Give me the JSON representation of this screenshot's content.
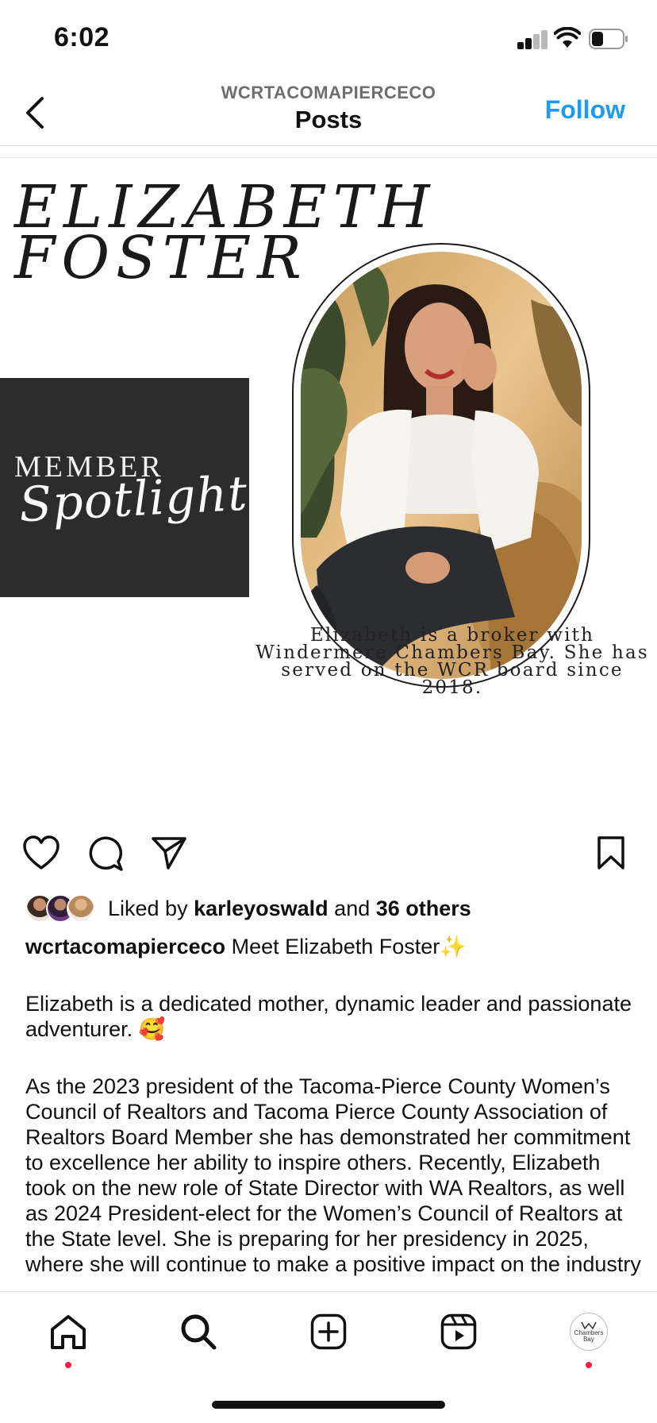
{
  "status_bar": {
    "time": "6:02",
    "icons": [
      "cellular-signal-icon",
      "wifi-icon",
      "battery-icon"
    ]
  },
  "header": {
    "username": "WCRTACOMAPIERCECO",
    "title": "Posts",
    "follow_label": "Follow",
    "back_icon": "chevron-left-icon",
    "follow_color": "#1d9bf0"
  },
  "post_image": {
    "name_line1": "ELIZABETH",
    "name_line2": "FOSTER",
    "member_label": "MEMBER",
    "spotlight_label": "Spotlight",
    "overlay_text": "Elizabeth is a broker with Windermere Chambers Bay.  She has served on the WCR board since 2018."
  },
  "actions": {
    "icons": [
      "heart-icon",
      "comment-icon",
      "share-icon",
      "bookmark-icon"
    ]
  },
  "likes": {
    "prefix": "Liked by ",
    "liker": "karleyoswald",
    "middle": " and ",
    "others": "36 others"
  },
  "caption": {
    "username": "wcrtacomapierceco",
    "text": " Meet Elizabeth Foster✨",
    "paragraph1": "Elizabeth is a dedicated mother, dynamic leader and passionate adventurer. 🥰",
    "paragraph2": "As the 2023 president of the Tacoma-Pierce County Women’s Council of Realtors and Tacoma Pierce County Association of Realtors Board Member she has demonstrated her commitment to excellence her ability to inspire others.  Recently, Elizabeth took on the new role of State Director with WA Realtors, as well as 2024 President-elect for the Women’s Council of Realtors at the State level. She is preparing for her presidency in 2025, where she will continue to make a positive impact on the industry"
  },
  "bottom_nav": {
    "items": [
      "home-icon",
      "search-icon",
      "create-icon",
      "reels-icon",
      "profile-avatar"
    ],
    "profile_text_1": "Chambers",
    "profile_text_2": "Bay",
    "notification_color": "#ff1a4b"
  }
}
